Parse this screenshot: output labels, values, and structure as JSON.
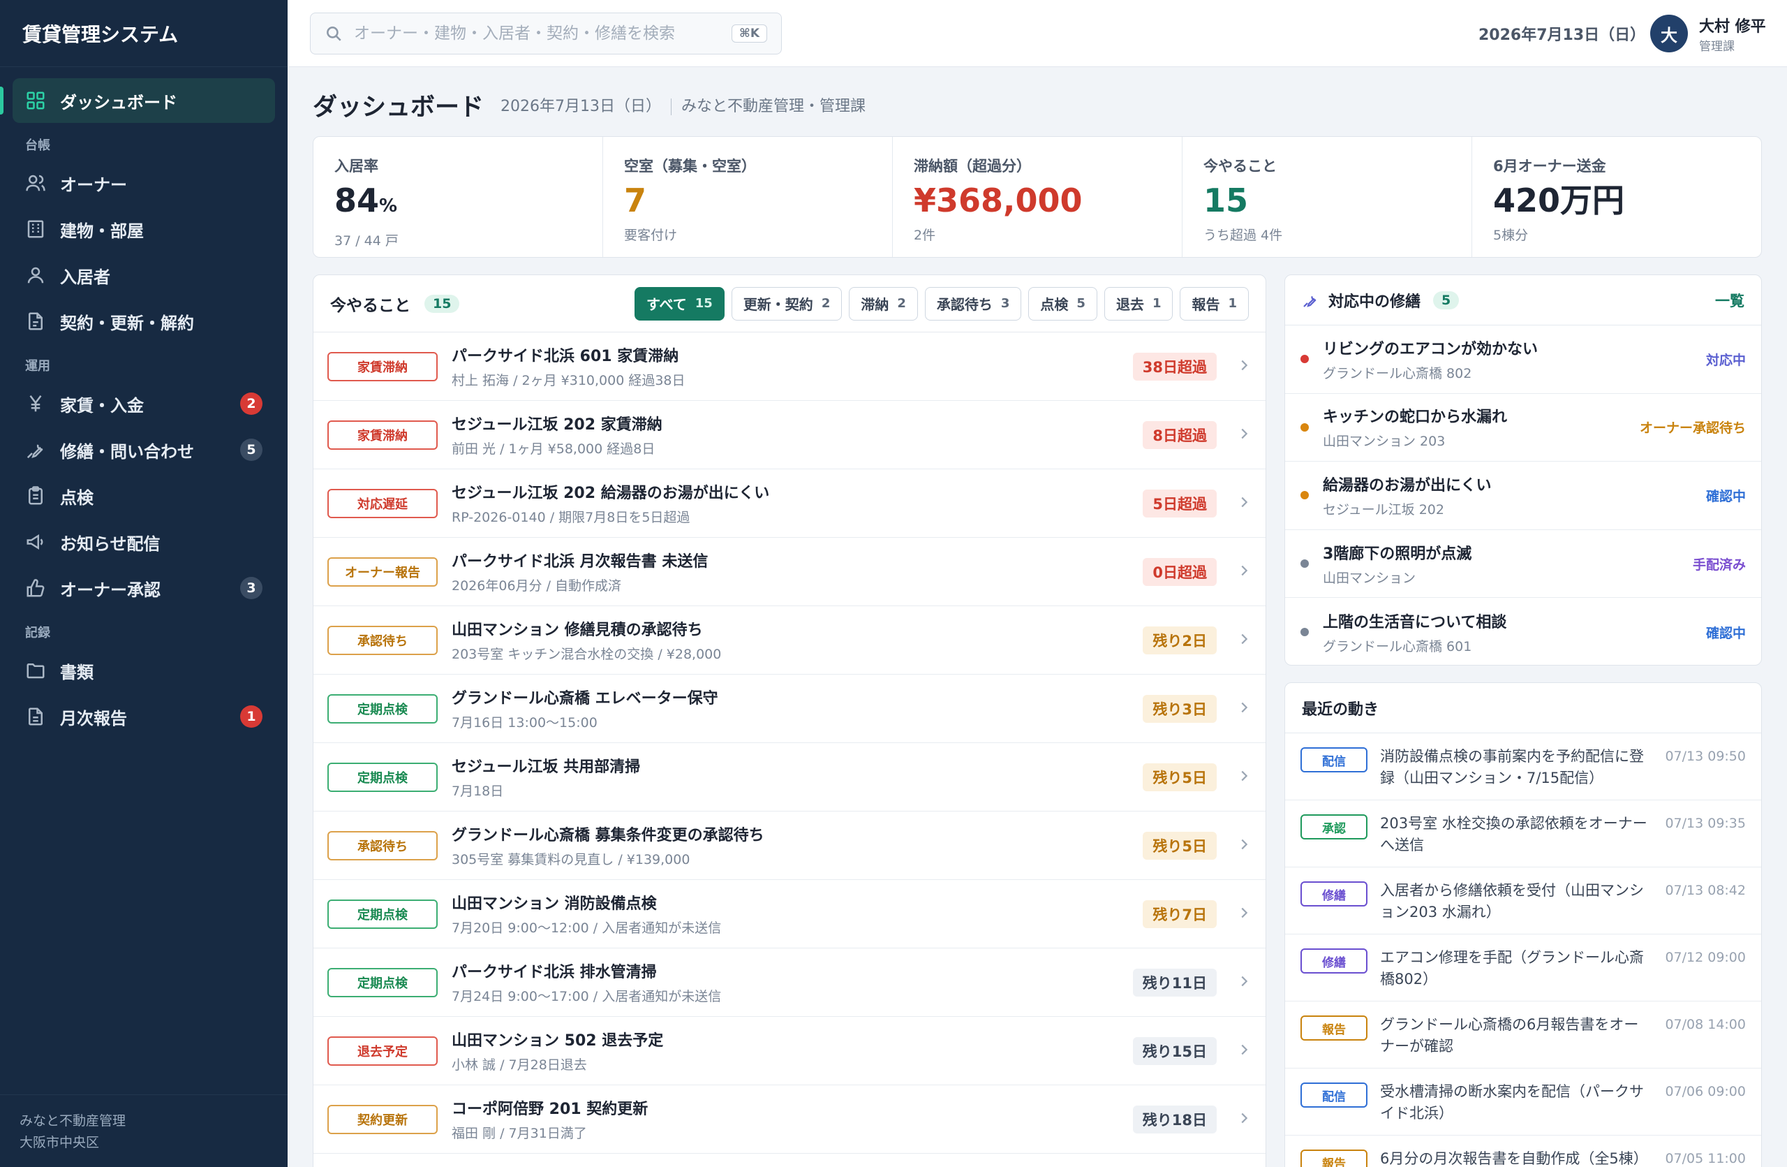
{
  "app": {
    "title": "賃貸管理システム"
  },
  "sidebar": {
    "items": [
      {
        "label": "ダッシュボード",
        "section": "",
        "icon": "dashboard-icon",
        "badge": "",
        "badge_color": "",
        "active": true
      },
      {
        "label": "オーナー",
        "section": "台帳",
        "icon": "users-icon",
        "badge": "",
        "badge_color": ""
      },
      {
        "label": "建物・部屋",
        "section": "",
        "icon": "building-icon",
        "badge": "",
        "badge_color": ""
      },
      {
        "label": "入居者",
        "section": "",
        "icon": "person-icon",
        "badge": "",
        "badge_color": ""
      },
      {
        "label": "契約・更新・解約",
        "section": "",
        "icon": "contract-icon",
        "badge": "",
        "badge_color": ""
      },
      {
        "label": "家賃・入金",
        "section": "運用",
        "icon": "yen-icon",
        "badge": "2",
        "badge_color": "red"
      },
      {
        "label": "修繕・問い合わせ",
        "section": "",
        "icon": "wrench-icon",
        "badge": "5",
        "badge_color": "gray"
      },
      {
        "label": "点検",
        "section": "",
        "icon": "clipboard-icon",
        "badge": "",
        "badge_color": ""
      },
      {
        "label": "お知らせ配信",
        "section": "",
        "icon": "megaphone-icon",
        "badge": "",
        "badge_color": ""
      },
      {
        "label": "オーナー承認",
        "section": "",
        "icon": "thumbs-up-icon",
        "badge": "3",
        "badge_color": "gray"
      },
      {
        "label": "書類",
        "section": "記録",
        "icon": "folder-icon",
        "badge": "",
        "badge_color": ""
      },
      {
        "label": "月次報告",
        "section": "",
        "icon": "document-icon",
        "badge": "1",
        "badge_color": "red"
      }
    ],
    "footer": {
      "company": "みなと不動産管理",
      "location": "大阪市中央区"
    }
  },
  "header": {
    "search_placeholder": "オーナー・建物・入居者・契約・修繕を検索",
    "search_shortcut": "⌘K",
    "date": "2026年7月13日（日）",
    "user": {
      "initial": "大",
      "name": "大村 修平",
      "role": "管理課"
    }
  },
  "page": {
    "title": "ダッシュボード",
    "date": "2026年7月13日（日）",
    "org": "みなと不動産管理・管理課"
  },
  "kpis": [
    {
      "label": "入居率",
      "value": "84",
      "unit": "%",
      "note": "37 / 44 戸",
      "color": "#1e2533"
    },
    {
      "label": "空室（募集・空室）",
      "value": "7",
      "unit": "",
      "note": "要客付け",
      "color": "#c9830e"
    },
    {
      "label": "滞納額（超過分）",
      "value": "¥368,000",
      "unit": "",
      "note": "2件",
      "color": "#cf3a2c"
    },
    {
      "label": "今やること",
      "value": "15",
      "unit": "",
      "note": "うち超過 4件",
      "color": "#157a62"
    },
    {
      "label": "6月オーナー送金",
      "value": "420万円",
      "unit": "",
      "note": "5棟分",
      "color": "#1e2533"
    }
  ],
  "todo": {
    "title": "今やること",
    "count": "15",
    "filters": [
      {
        "label": "すべて",
        "count": "15",
        "active": true
      },
      {
        "label": "更新・契約",
        "count": "2"
      },
      {
        "label": "滞納",
        "count": "2"
      },
      {
        "label": "承認待ち",
        "count": "3"
      },
      {
        "label": "点検",
        "count": "5"
      },
      {
        "label": "退去",
        "count": "1"
      },
      {
        "label": "報告",
        "count": "1"
      }
    ],
    "rows": [
      {
        "tag": "家賃滞納",
        "tag_style": "red",
        "title": "パークサイド北浜 601 家賃滞納",
        "sub": "村上 拓海 / 2ヶ月 ¥310,000 経過38日",
        "due": "38日超過",
        "due_style": "red"
      },
      {
        "tag": "家賃滞納",
        "tag_style": "red",
        "title": "セジュール江坂 202 家賃滞納",
        "sub": "前田 光 / 1ヶ月 ¥58,000 経過8日",
        "due": "8日超過",
        "due_style": "red"
      },
      {
        "tag": "対応遅延",
        "tag_style": "red",
        "title": "セジュール江坂 202 給湯器のお湯が出にくい",
        "sub": "RP-2026-0140 / 期限7月8日を5日超過",
        "due": "5日超過",
        "due_style": "red"
      },
      {
        "tag": "オーナー報告",
        "tag_style": "orange",
        "title": "パークサイド北浜 月次報告書 未送信",
        "sub": "2026年06月分 / 自動作成済",
        "due": "0日超過",
        "due_style": "red"
      },
      {
        "tag": "承認待ち",
        "tag_style": "orange",
        "title": "山田マンション 修繕見積の承認待ち",
        "sub": "203号室 キッチン混合水栓の交換 / ¥28,000",
        "due": "残り2日",
        "due_style": "orange"
      },
      {
        "tag": "定期点検",
        "tag_style": "green",
        "title": "グランドール心斎橋 エレベーター保守",
        "sub": "7月16日 13:00〜15:00",
        "due": "残り3日",
        "due_style": "orange"
      },
      {
        "tag": "定期点検",
        "tag_style": "green",
        "title": "セジュール江坂 共用部清掃",
        "sub": "7月18日",
        "due": "残り5日",
        "due_style": "orange"
      },
      {
        "tag": "承認待ち",
        "tag_style": "orange",
        "title": "グランドール心斎橋 募集条件変更の承認待ち",
        "sub": "305号室 募集賃料の見直し / ¥139,000",
        "due": "残り5日",
        "due_style": "orange"
      },
      {
        "tag": "定期点検",
        "tag_style": "green",
        "title": "山田マンション 消防設備点検",
        "sub": "7月20日 9:00〜12:00 / 入居者通知が未送信",
        "due": "残り7日",
        "due_style": "orange"
      },
      {
        "tag": "定期点検",
        "tag_style": "green",
        "title": "パークサイド北浜 排水管清掃",
        "sub": "7月24日 9:00〜17:00 / 入居者通知が未送信",
        "due": "残り11日",
        "due_style": "gray"
      },
      {
        "tag": "退去予定",
        "tag_style": "red",
        "title": "山田マンション 502 退去予定",
        "sub": "小林 誠 / 7月28日退去",
        "due": "残り15日",
        "due_style": "gray"
      },
      {
        "tag": "契約更新",
        "tag_style": "orange",
        "title": "コーポ阿倍野 201 契約更新",
        "sub": "福田 剛 / 7月31日満了",
        "due": "残り18日",
        "due_style": "gray"
      }
    ]
  },
  "repairs": {
    "title": "対応中の修繕",
    "count": "5",
    "link": "一覧",
    "rows": [
      {
        "title": "リビングのエアコンが効かない",
        "sub": "グランドール心斎橋 802",
        "status": "対応中",
        "dot": "#d83a35",
        "status_color": "#5a5fd0"
      },
      {
        "title": "キッチンの蛇口から水漏れ",
        "sub": "山田マンション 203",
        "status": "オーナー承認待ち",
        "dot": "#d9860f",
        "status_color": "#c9830e"
      },
      {
        "title": "給湯器のお湯が出にくい",
        "sub": "セジュール江坂 202",
        "status": "確認中",
        "dot": "#d9860f",
        "status_color": "#2f6fd6"
      },
      {
        "title": "3階廊下の照明が点滅",
        "sub": "山田マンション",
        "status": "手配済み",
        "dot": "#7a8595",
        "status_color": "#7b4fd0"
      },
      {
        "title": "上階の生活音について相談",
        "sub": "グランドール心斎橋 601",
        "status": "確認中",
        "dot": "#7a8595",
        "status_color": "#2f6fd6"
      }
    ]
  },
  "activity": {
    "title": "最近の動き",
    "rows": [
      {
        "tag": "配信",
        "color": "#2f6fd6",
        "text": "消防設備点検の事前案内を予約配信に登録（山田マンション・7/15配信）",
        "time": "07/13 09:50"
      },
      {
        "tag": "承認",
        "color": "#1f9a5c",
        "text": "203号室 水栓交換の承認依頼をオーナーへ送信",
        "time": "07/13 09:35"
      },
      {
        "tag": "修繕",
        "color": "#6a4fd0",
        "text": "入居者から修繕依頼を受付（山田マンション203 水漏れ）",
        "time": "07/13 08:42"
      },
      {
        "tag": "修繕",
        "color": "#6a4fd0",
        "text": "エアコン修理を手配（グランドール心斎橋802）",
        "time": "07/12 09:00"
      },
      {
        "tag": "報告",
        "color": "#c9830e",
        "text": "グランドール心斎橋の6月報告書をオーナーが確認",
        "time": "07/08 14:00"
      },
      {
        "tag": "配信",
        "color": "#2f6fd6",
        "text": "受水槽清掃の断水案内を配信（パークサイド北浜）",
        "time": "07/06 09:00"
      },
      {
        "tag": "報告",
        "color": "#c9830e",
        "text": "6月分の月次報告書を自動作成（全5棟）",
        "time": "07/05 11:00"
      }
    ]
  }
}
